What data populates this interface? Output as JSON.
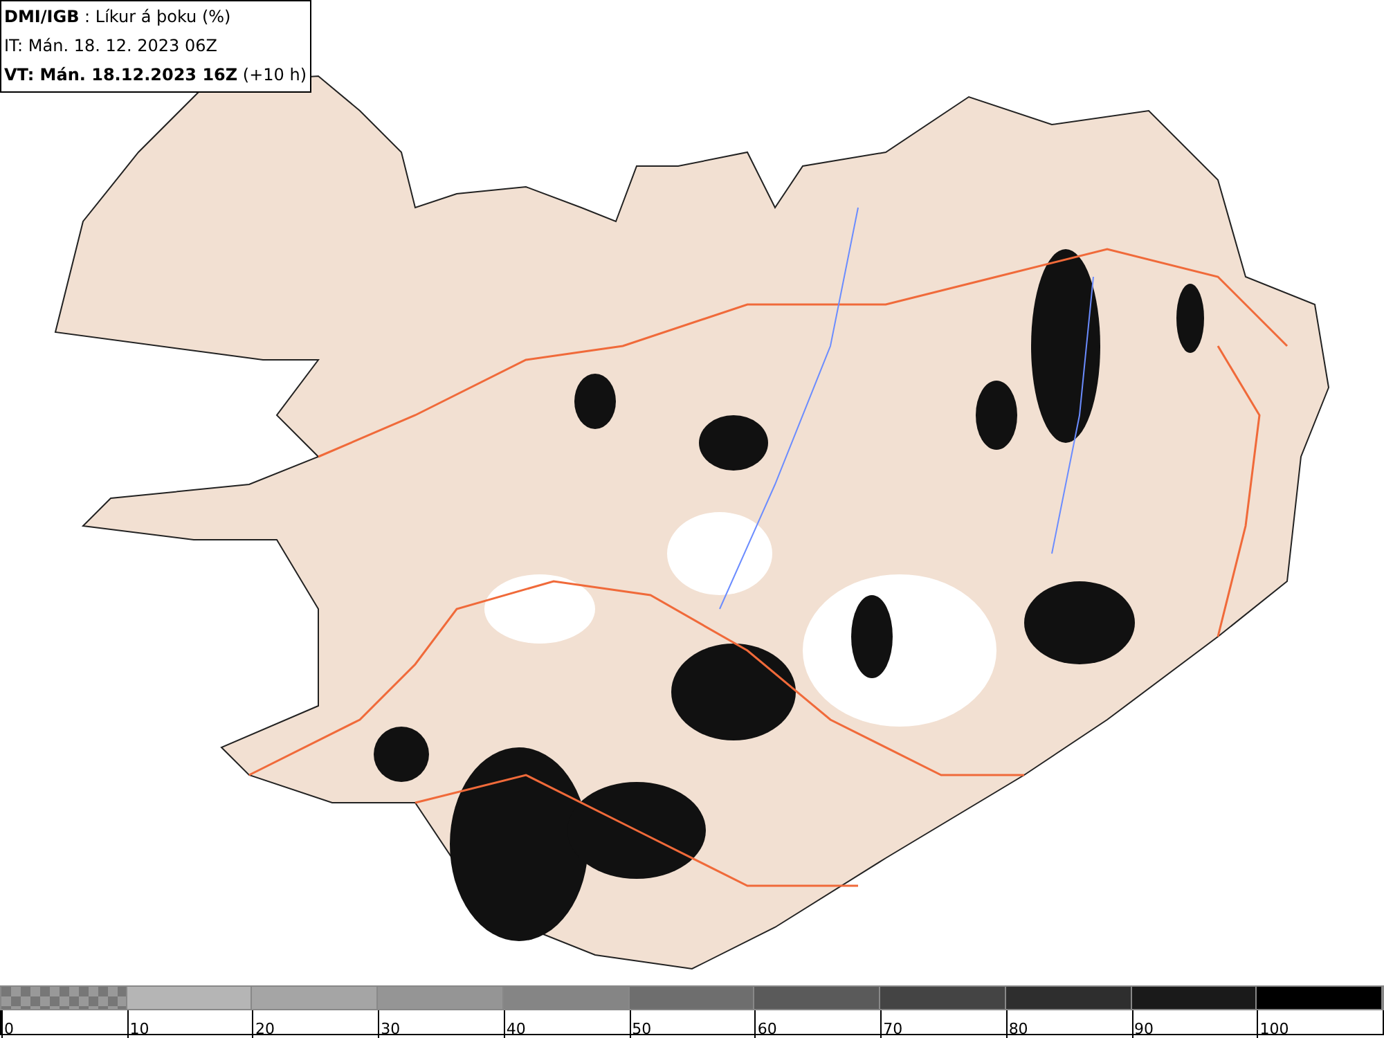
{
  "header": {
    "lines": [
      "**DMI/IGB** : Líkur á þoku (%)",
      "IT: Mán. 18. 12. 2023 06Z",
      "**VT: Mán. 18.12.2023 16Z** (+10 h)"
    ]
  },
  "legend": {
    "segments": [
      {
        "kind": "checker",
        "color": "#777777",
        "label": "0"
      },
      {
        "kind": "solid",
        "color": "#b5b5b5",
        "label": "10"
      },
      {
        "kind": "solid",
        "color": "#a5a5a5",
        "label": "20"
      },
      {
        "kind": "solid",
        "color": "#959595",
        "label": "30"
      },
      {
        "kind": "solid",
        "color": "#858585",
        "label": "40"
      },
      {
        "kind": "solid",
        "color": "#6e6e6e",
        "label": "50"
      },
      {
        "kind": "solid",
        "color": "#5a5a5a",
        "label": "60"
      },
      {
        "kind": "solid",
        "color": "#444444",
        "label": "70"
      },
      {
        "kind": "solid",
        "color": "#2e2e2e",
        "label": "80"
      },
      {
        "kind": "solid",
        "color": "#1a1a1a",
        "label": "90"
      },
      {
        "kind": "solid",
        "color": "#000000",
        "label": "100"
      }
    ]
  }
}
